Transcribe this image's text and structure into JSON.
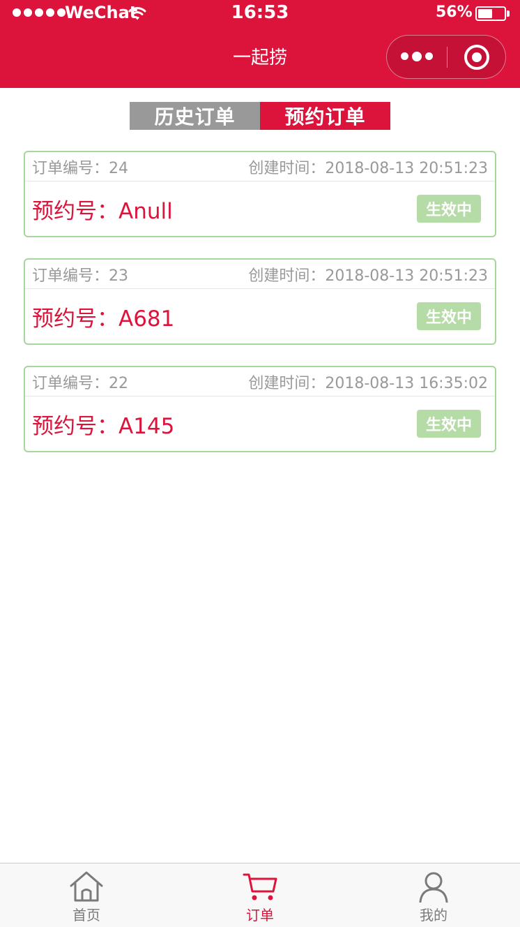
{
  "status_bar": {
    "carrier": "WeChat",
    "time": "16:53",
    "battery": "56%",
    "battery_level": 0.56
  },
  "nav": {
    "title": "一起捞",
    "icons": [
      "more-icon",
      "close-icon"
    ]
  },
  "tabs": [
    {
      "label": "历史订单",
      "active": false
    },
    {
      "label": "预约订单",
      "active": true
    }
  ],
  "orders": [
    {
      "order_label": "订单编号：24",
      "created_label": "创建时间：2018-08-13 20:51:23",
      "booking_label": "预约号：Anull",
      "status": "生效中"
    },
    {
      "order_label": "订单编号：23",
      "created_label": "创建时间：2018-08-13 20:51:23",
      "booking_label": "预约号：A681",
      "status": "生效中"
    },
    {
      "order_label": "订单编号：22",
      "created_label": "创建时间：2018-08-13 16:35:02",
      "booking_label": "预约号：A145",
      "status": "生效中"
    }
  ],
  "tabbar": [
    {
      "label": "首页",
      "icon": "home-icon",
      "active": false
    },
    {
      "label": "订单",
      "icon": "cart-icon",
      "active": true
    },
    {
      "label": "我的",
      "icon": "user-icon",
      "active": false
    }
  ],
  "colors": {
    "brand": "#dc143c",
    "tab_inactive": "#999999",
    "card_border": "#a6d79a",
    "status_badge": "#b5dba6",
    "muted_text": "#999999"
  }
}
